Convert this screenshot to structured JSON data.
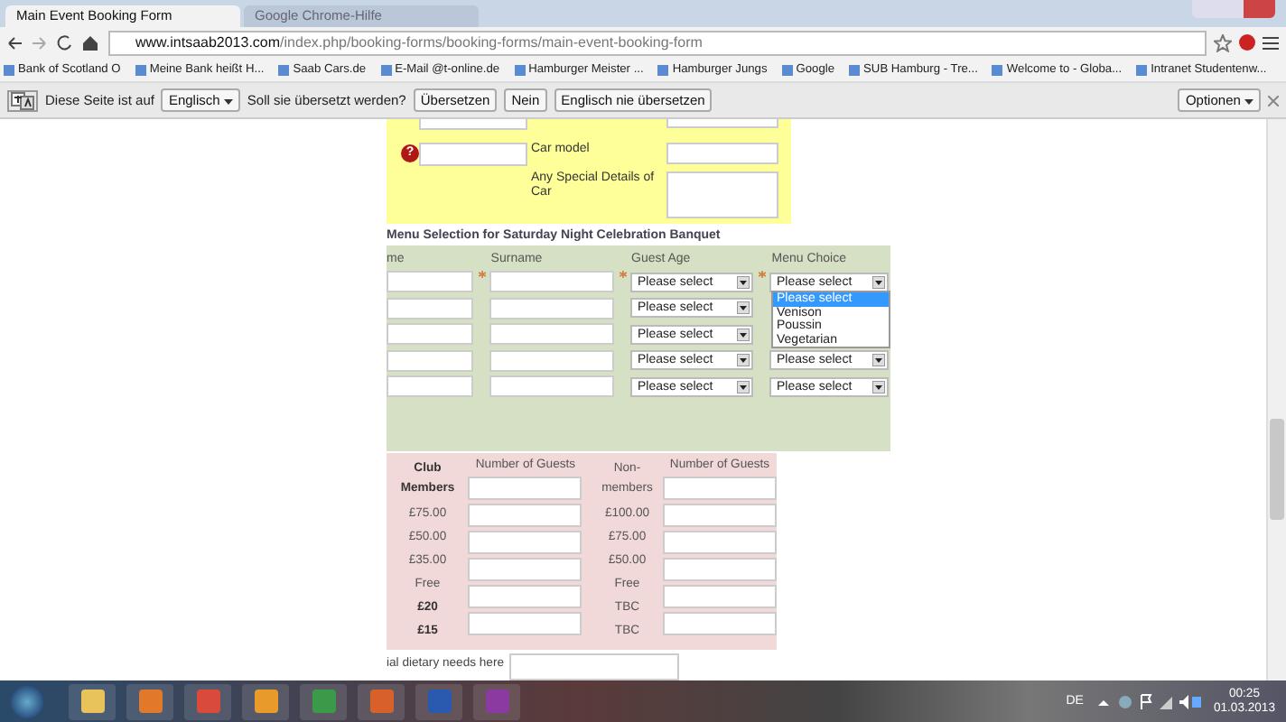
{
  "browser_tabs": [
    {
      "title": "Main Event Booking Form",
      "selected": true
    },
    {
      "title": "Google Chrome-Hilfe",
      "selected": false
    }
  ],
  "address_bar": {
    "host": "www.intsaab2013.com",
    "path": "/index.php/booking-forms/booking-forms/main-event-booking-form"
  },
  "bookmarks": [
    "Bank of Scotland O",
    "Meine Bank heißt H...",
    "Saab Cars.de",
    "E-Mail @t-online.de",
    "Hamburger Meister ...",
    "Hamburger Jungs",
    "Google",
    "SUB Hamburg - Tre...",
    "Welcome to - Globa...",
    "Intranet Studentenw..."
  ],
  "translate_bar": {
    "prefix": "Diese Seite ist auf",
    "language": "Englisch",
    "question": "Soll sie übersetzt werden?",
    "buttons": [
      "Übersetzen",
      "Nein",
      "Englisch nie übersetzen"
    ],
    "options": "Optionen"
  },
  "car_section": {
    "help_mark": "?",
    "labels": [
      "Car model",
      "Any Special Details of Car"
    ]
  },
  "menu_section": {
    "heading": "Menu Selection for Saturday Night Celebration Banquet",
    "columns": [
      "me",
      "Surname",
      "Guest Age",
      "Menu Choice"
    ],
    "rows": [
      {
        "required": true,
        "guest_age": "Please select",
        "menu_choice": "Please select"
      },
      {
        "required": false,
        "guest_age": "Please select"
      },
      {
        "required": false,
        "guest_age": "Please select"
      },
      {
        "required": false,
        "guest_age": "Please select",
        "menu_choice": "Please select"
      },
      {
        "required": false,
        "guest_age": "Please select",
        "menu_choice": "Please select"
      }
    ],
    "dropdown_options": [
      {
        "label": "Please select",
        "selected": true
      },
      {
        "label": "Venison",
        "selected": false
      },
      {
        "label": "Poussin",
        "selected": false
      },
      {
        "label": "Vegetarian",
        "selected": false
      }
    ]
  },
  "pricing": {
    "headers": [
      "Number of Guests",
      "Number of Guests"
    ],
    "club": [
      {
        "label": "Club Members",
        "bold": true
      },
      {
        "label": "£75.00",
        "bold": false
      },
      {
        "label": "£50.00",
        "bold": false
      },
      {
        "label": "£35.00",
        "bold": false
      },
      {
        "label": "Free",
        "bold": false
      },
      {
        "label": "£20",
        "bold": true
      },
      {
        "label": "£15",
        "bold": true
      }
    ],
    "non_members": [
      {
        "label": "Non-members",
        "bold": false
      },
      {
        "label": "£100.00",
        "bold": false
      },
      {
        "label": "£75.00",
        "bold": false
      },
      {
        "label": "£50.00",
        "bold": false
      },
      {
        "label": "Free",
        "bold": false
      },
      {
        "label": "TBC",
        "bold": false
      },
      {
        "label": "TBC",
        "bold": false
      }
    ]
  },
  "dietary_label": "ial dietary needs here",
  "taskbar": {
    "language": "DE",
    "time": "00:25",
    "date": "01.03.2013"
  }
}
